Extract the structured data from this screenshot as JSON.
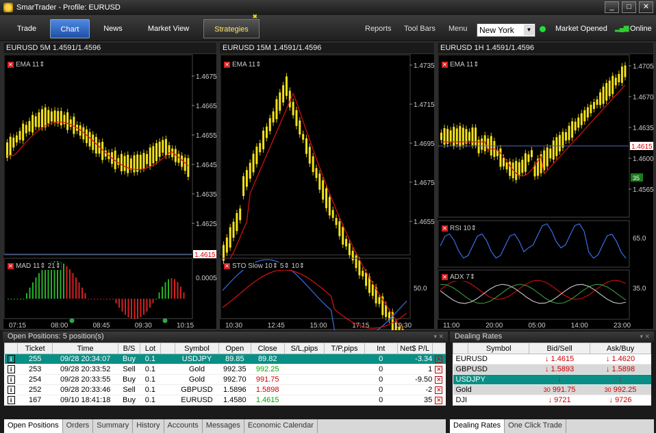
{
  "title": "SmarTrader - Profile: EURUSD",
  "window_buttons": {
    "min": "_",
    "max": "□",
    "close": "✕"
  },
  "nav": {
    "tabs": [
      "Trade",
      "Chart",
      "News",
      "Market View",
      "Strategies"
    ],
    "active": "Chart",
    "right": [
      "Reports",
      "Tool Bars",
      "Menu"
    ]
  },
  "city": "New York",
  "market_status": "Market Opened",
  "connection": "Online",
  "charts": [
    {
      "header": "EURUSD 5M 1.4591/1.4596",
      "indicator": "EMA",
      "ema_period": "11",
      "price_labels": [
        "1.4675",
        "1.4665",
        "1.4655",
        "1.4645",
        "1.4635",
        "1.4625"
      ],
      "current_price": "1.4615",
      "sub_indicator": "MAD",
      "sub_p1": "11",
      "sub_p2": "21",
      "sub_labels": [
        "0.0005"
      ],
      "time_labels": [
        "07:15",
        "08:00",
        "08:45",
        "09:30",
        "10:15"
      ]
    },
    {
      "header": "EURUSD 15M 1.4591/1.4596",
      "indicator": "EMA",
      "ema_period": "11",
      "price_labels": [
        "1.4735",
        "1.4715",
        "1.4695",
        "1.4675",
        "1.4655"
      ],
      "sub_indicator": "STO Slow",
      "sub_p1": "10",
      "sub_p2": "5",
      "sub_p3": "10",
      "sub_labels": [
        "50.0"
      ],
      "time_labels": [
        "10:30",
        "12:45",
        "15:00",
        "17:15",
        "19:30"
      ]
    },
    {
      "header": "EURUSD 1H 1.4591/1.4596",
      "indicator": "EMA",
      "ema_period": "11",
      "price_labels": [
        "1.4705",
        "1.4670",
        "1.4635",
        "1.4600",
        "1.4565"
      ],
      "current_price": "1.4615",
      "badge": "35",
      "rsi_label": "RSI",
      "rsi_period": "10",
      "rsi_value": "65.0",
      "adx_label": "ADX",
      "adx_period": "7",
      "adx_value": "35.0",
      "time_labels": [
        "11:00",
        "20:00",
        "05:00",
        "14:00",
        "23:00"
      ]
    }
  ],
  "positions": {
    "title": "Open Positions: 5 position(s)",
    "columns": [
      "",
      "Ticket",
      "Time",
      "B/S",
      "Lot",
      "",
      "Symbol",
      "Open",
      "Close",
      "S/L,pips",
      "T/P,pips",
      "Int",
      "Net$ P/L",
      ""
    ],
    "rows": [
      {
        "ticket": "255",
        "time": "09/28 20:34:07",
        "bs": "Buy",
        "lot": "0.1",
        "symbol": "USDJPY",
        "open": "89.85",
        "close": "89.82",
        "int": "0",
        "pl": "-3.34"
      },
      {
        "ticket": "253",
        "time": "09/28 20:33:52",
        "bs": "Sell",
        "lot": "0.1",
        "symbol": "Gold",
        "open": "992.35",
        "close": "992.25",
        "int": "0",
        "pl": "1"
      },
      {
        "ticket": "254",
        "time": "09/28 20:33:55",
        "bs": "Buy",
        "lot": "0.1",
        "symbol": "Gold",
        "open": "992.70",
        "close": "991.75",
        "int": "0",
        "pl": "-9.50"
      },
      {
        "ticket": "252",
        "time": "09/28 20:33:46",
        "bs": "Sell",
        "lot": "0.1",
        "symbol": "GBPUSD",
        "open": "1.5896",
        "close": "1.5898",
        "int": "0",
        "pl": "-2"
      },
      {
        "ticket": "167",
        "time": "09/10 18:41:18",
        "bs": "Buy",
        "lot": "0.1",
        "symbol": "EURUSD",
        "open": "1.4580",
        "close": "1.4615",
        "int": "0",
        "pl": "35"
      }
    ],
    "tabs": [
      "Open Positions",
      "Orders",
      "Summary",
      "History",
      "Accounts",
      "Messages",
      "Economic Calendar"
    ]
  },
  "rates": {
    "title": "Dealing Rates",
    "columns": [
      "Symbol",
      "Bid/Sell",
      "Ask/Buy"
    ],
    "rows": [
      {
        "symbol": "EURUSD",
        "bid": "1.4615",
        "ask": "1.4620"
      },
      {
        "symbol": "GBPUSD",
        "bid": "1.5893",
        "ask": "1.5898"
      },
      {
        "symbol": "USDJPY",
        "bid": "",
        "ask": ""
      },
      {
        "symbol": "Gold",
        "bid_prefix": "30",
        "bid": "991.75",
        "ask_prefix": "30",
        "ask": "992.25"
      },
      {
        "symbol": "DJI",
        "bid": "9721",
        "ask": "9726"
      }
    ],
    "tabs": [
      "Dealing Rates",
      "One Click Trade"
    ]
  }
}
